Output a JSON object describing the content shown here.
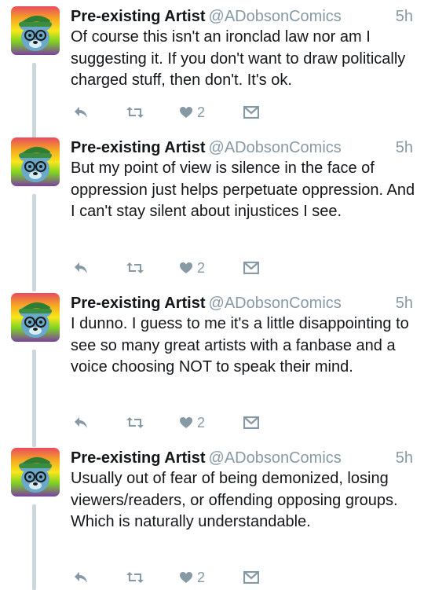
{
  "tweets": [
    {
      "name": "Pre-existing Artist",
      "handle": "@ADobsonComics",
      "time": "5h",
      "text": "Of course this isn't an ironclad law nor am I suggesting it. If you don't want to draw politically charged stuff, then don't. It's ok.",
      "likes": "2"
    },
    {
      "name": "Pre-existing Artist",
      "handle": "@ADobsonComics",
      "time": "5h",
      "text": "But my point of view is silence in the face of oppression just helps perpetuate oppression. And I can't stay silent about injustices I see.",
      "likes": "2"
    },
    {
      "name": "Pre-existing Artist",
      "handle": "@ADobsonComics",
      "time": "5h",
      "text": "I dunno. I guess to me it's a little disappointing to see so many great artists with a fanbase and a voice choosing NOT to speak their mind.",
      "likes": "2"
    },
    {
      "name": "Pre-existing Artist",
      "handle": "@ADobsonComics",
      "time": "5h",
      "text": "Usually out of fear of being demonized, losing viewers/readers, or offending opposing groups. Which is naturally understandable.",
      "likes": "2"
    }
  ],
  "icons": {
    "reply": "reply-icon",
    "retweet": "retweet-icon",
    "like": "heart-icon",
    "message": "direct-message-icon"
  },
  "colors": {
    "icon_gray": "#8899a6",
    "text": "#14171a",
    "thread_line": "#ccd6dd"
  }
}
